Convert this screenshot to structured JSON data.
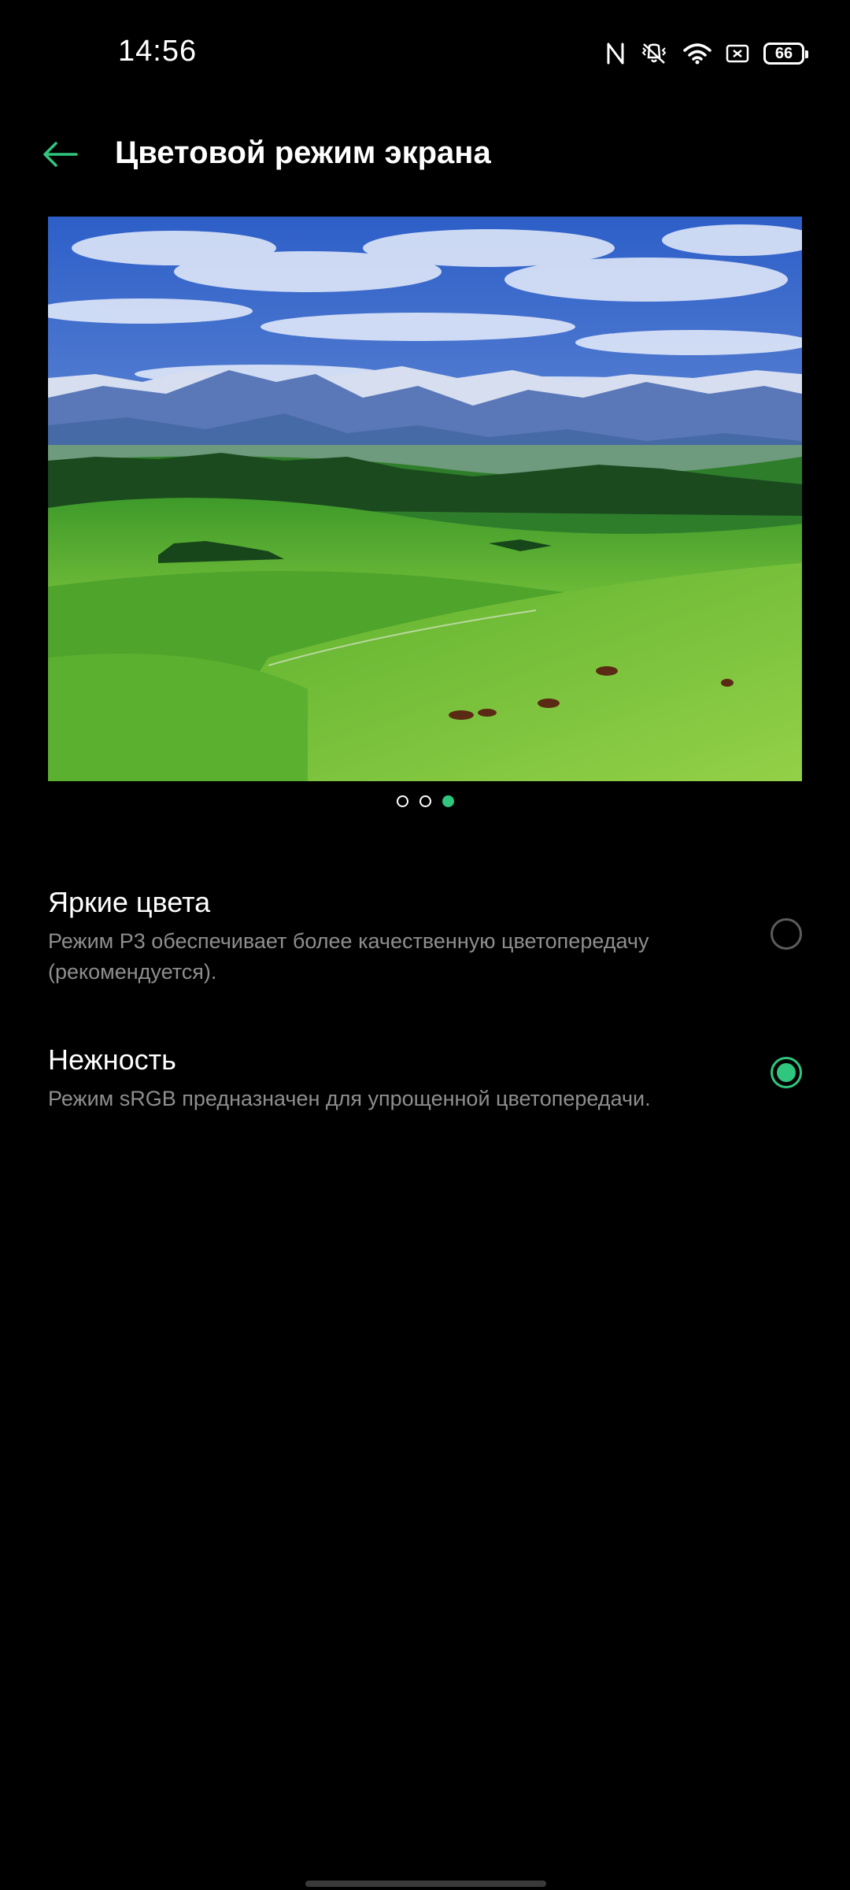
{
  "status_bar": {
    "time": "14:56",
    "battery": "66",
    "icons": [
      "nfc-icon",
      "vibrate-icon",
      "wifi-icon",
      "screen-record-icon",
      "battery-icon"
    ]
  },
  "header": {
    "back_icon": "arrow-left-icon",
    "title": "Цветовой режим экрана"
  },
  "preview": {
    "image": "landscape-meadow-image",
    "pages": 3,
    "active_page": 3
  },
  "options": [
    {
      "title": "Яркие цвета",
      "description": "Режим P3 обеспечивает более качественную цветопередачу (рекомендуется).",
      "selected": false
    },
    {
      "title": "Нежность",
      "description": "Режим sRGB предназначен для упрощенной цветопередачи.",
      "selected": true
    }
  ],
  "colors": {
    "accent": "#2fc67e",
    "background": "#000000",
    "secondary_text": "#8e8e8e"
  }
}
